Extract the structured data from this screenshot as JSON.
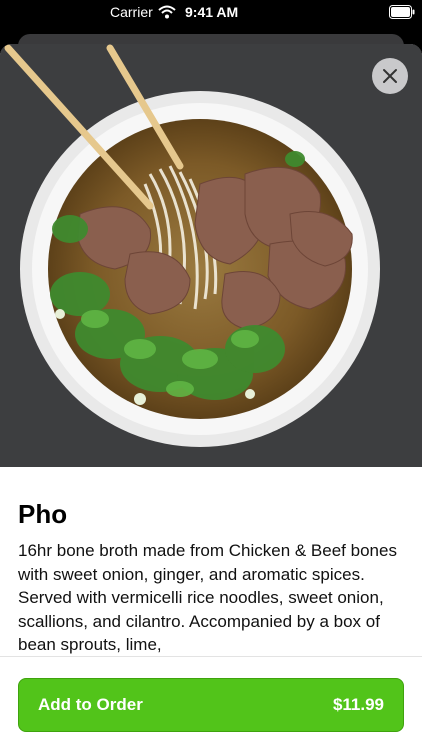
{
  "status_bar": {
    "carrier": "Carrier",
    "time": "9:41 AM"
  },
  "item": {
    "image": "pho-bowl-photo",
    "title": "Pho",
    "description": "16hr bone broth made from Chicken & Beef bones with sweet onion, ginger, and aromatic spices. Served with vermicelli rice noodles, sweet onion, scallions, and cilantro. Accompanied by a box of bean sprouts, lime,"
  },
  "actions": {
    "close_icon": "close-icon",
    "add_label": "Add to Order",
    "price": "$11.99"
  },
  "colors": {
    "accent": "#52c41a"
  }
}
